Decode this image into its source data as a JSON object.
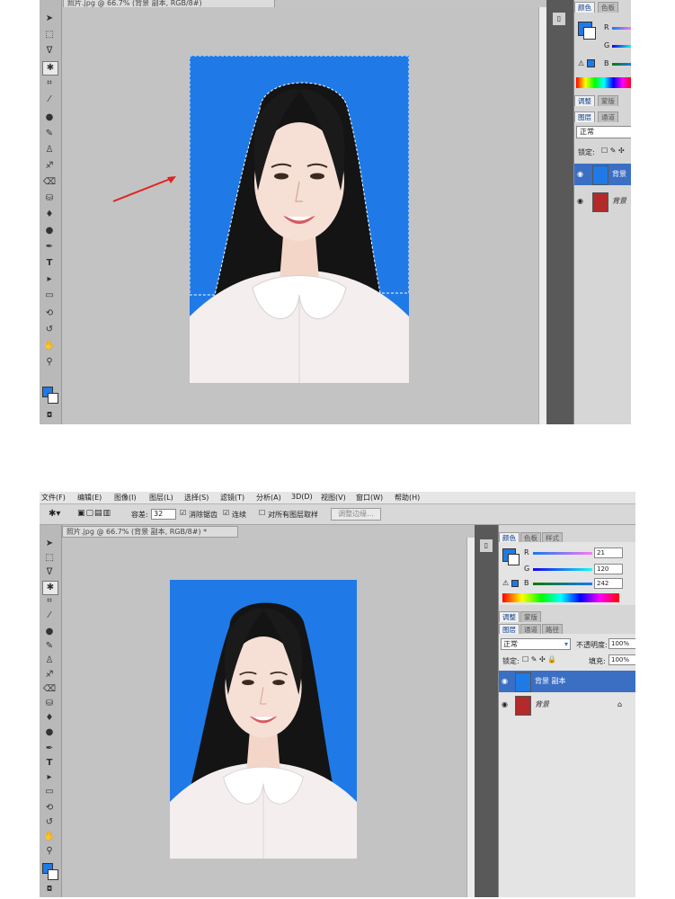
{
  "top": {
    "doc_tab": "照片.jpg @ 66.7% (背景 副本, RGB/8#)",
    "panel_tabs": [
      "颜色",
      "色板"
    ],
    "channels": [
      "R",
      "G",
      "B"
    ],
    "adjust_tabs": [
      "调整",
      "蒙版"
    ],
    "layer_tabs": [
      "图层",
      "通道"
    ],
    "blend_mode": "正常",
    "lock_label": "锁定:",
    "layers": [
      "背景",
      "背景"
    ]
  },
  "bottom": {
    "menu": [
      "文件(F)",
      "编辑(E)",
      "图像(I)",
      "图层(L)",
      "选择(S)",
      "滤镜(T)",
      "分析(A)",
      "3D(D)",
      "视图(V)",
      "窗口(W)",
      "帮助(H)"
    ],
    "options": {
      "tolerance_label": "容差:",
      "tolerance_value": "32",
      "antialias_label": "消除锯齿",
      "contiguous_label": "连续",
      "all_layers_label": "对所有图层取样",
      "refine_button": "调整边缘..."
    },
    "doc_tab": "照片.jpg @ 66.7% (背景 副本, RGB/8#) *",
    "panel_tabs": [
      "颜色",
      "色板",
      "样式"
    ],
    "channels": [
      {
        "label": "R",
        "value": "21"
      },
      {
        "label": "G",
        "value": "120"
      },
      {
        "label": "B",
        "value": "242"
      }
    ],
    "adjust_tabs": [
      "调整",
      "蒙版"
    ],
    "layer_tabs": [
      "图层",
      "通道",
      "路径"
    ],
    "blend_mode": "正常",
    "opacity_label": "不透明度:",
    "opacity_value": "100%",
    "lock_label": "锁定:",
    "fill_label": "填充:",
    "fill_value": "100%",
    "layers": [
      {
        "name": "背景 副本",
        "selected": true
      },
      {
        "name": "背景",
        "selected": false
      }
    ]
  },
  "colors": {
    "photo_bg": "#1f7ae8",
    "selected_layer": "#3b6fc4",
    "arrow": "#e0241f"
  }
}
